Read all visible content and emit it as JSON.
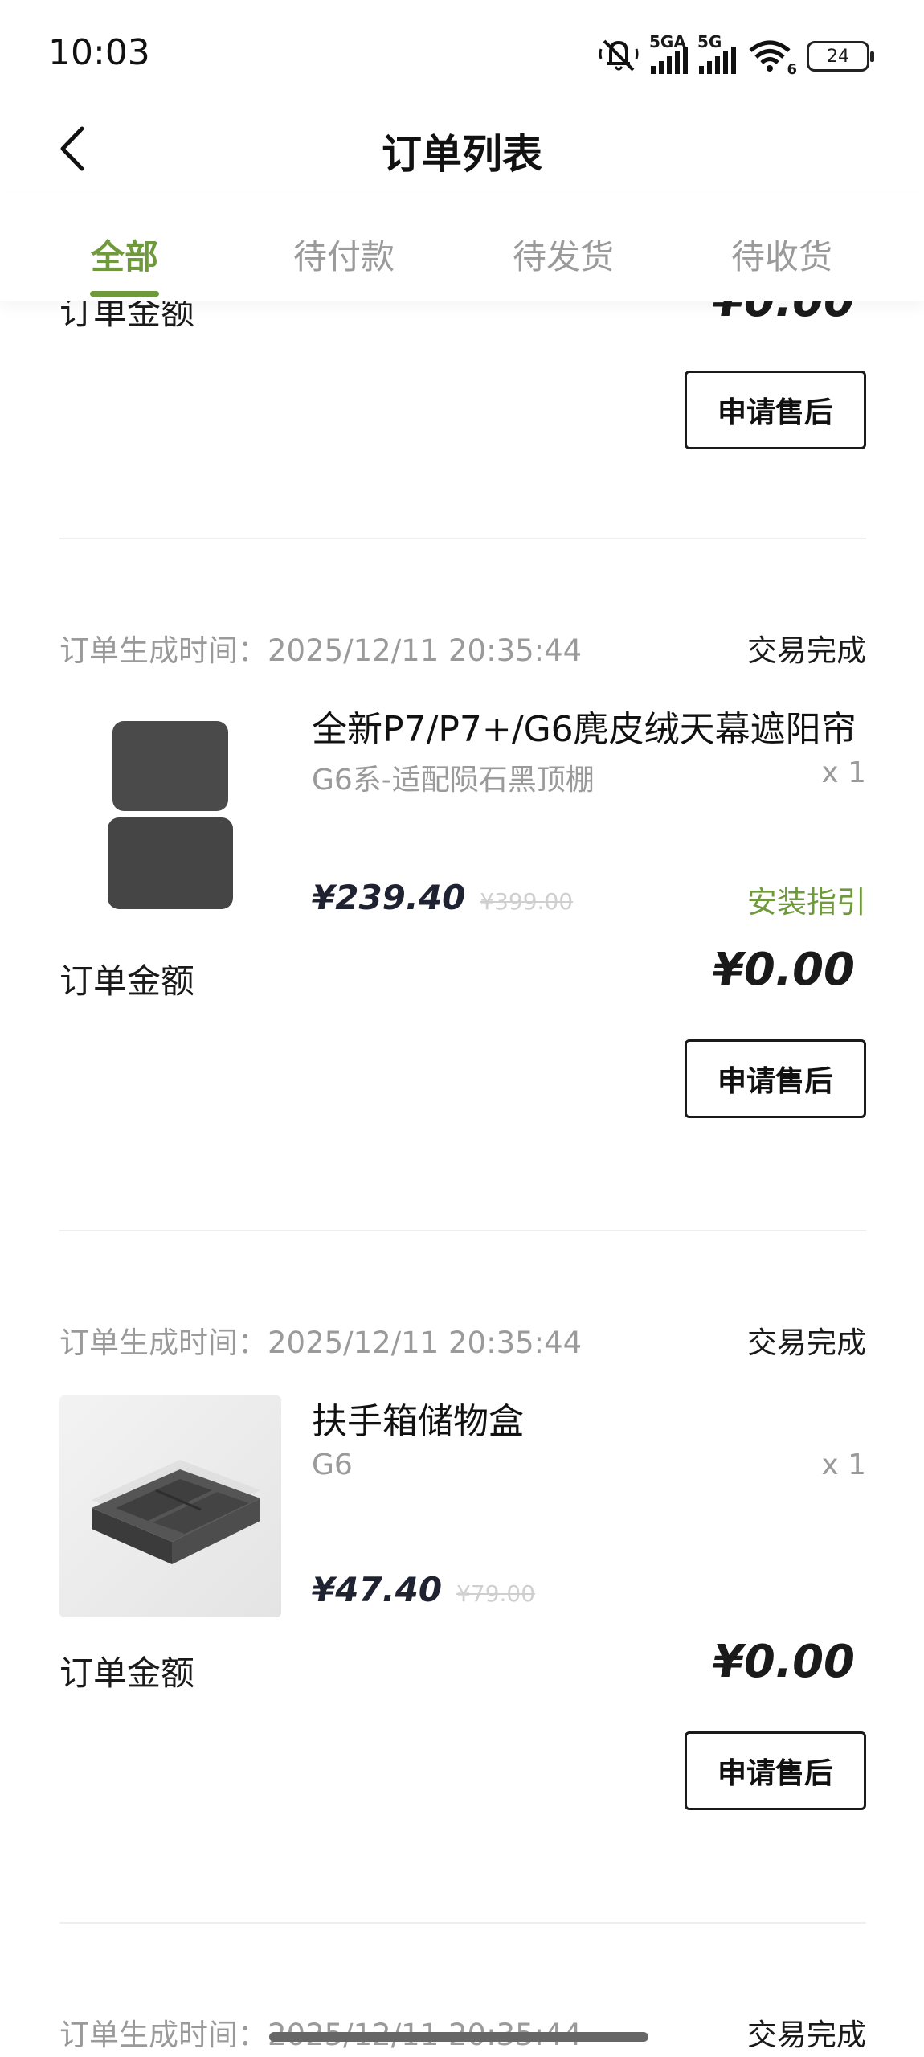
{
  "status_bar": {
    "time": "10:03",
    "signal1_label": "5GA",
    "signal2_label": "5G",
    "wifi_label": "6",
    "battery": "24"
  },
  "header": {
    "title": "订单列表"
  },
  "tabs": [
    {
      "label": "全部",
      "active": true
    },
    {
      "label": "待付款",
      "active": false
    },
    {
      "label": "待发货",
      "active": false
    },
    {
      "label": "待收货",
      "active": false
    }
  ],
  "orders": [
    {
      "amount_label": "订单金额",
      "amount": "¥0.00",
      "after_sale_label": "申请售后"
    },
    {
      "time_label": "订单生成时间：2025/12/11 20:35:44",
      "status": "交易完成",
      "product_name": "全新P7/P7+/G6麂皮绒天幕遮阳帘",
      "product_spec": "G6系-适配陨石黑顶棚",
      "quantity": "x 1",
      "price": "¥239.40",
      "original_price": "¥399.00",
      "install_link": "安装指引",
      "amount_label": "订单金额",
      "amount": "¥0.00",
      "after_sale_label": "申请售后"
    },
    {
      "time_label": "订单生成时间：2025/12/11 20:35:44",
      "status": "交易完成",
      "product_name": "扶手箱储物盒",
      "product_spec": "G6",
      "quantity": "x 1",
      "price": "¥47.40",
      "original_price": "¥79.00",
      "amount_label": "订单金额",
      "amount": "¥0.00",
      "after_sale_label": "申请售后"
    }
  ],
  "colors": {
    "accent": "#6f9a3c",
    "muted": "#9a9a9a",
    "text": "#1a1a1a"
  },
  "icons": {
    "back": "chevron-left-icon",
    "mute": "muted-bell-icon",
    "wifi": "wifi-icon",
    "battery": "battery-icon"
  }
}
